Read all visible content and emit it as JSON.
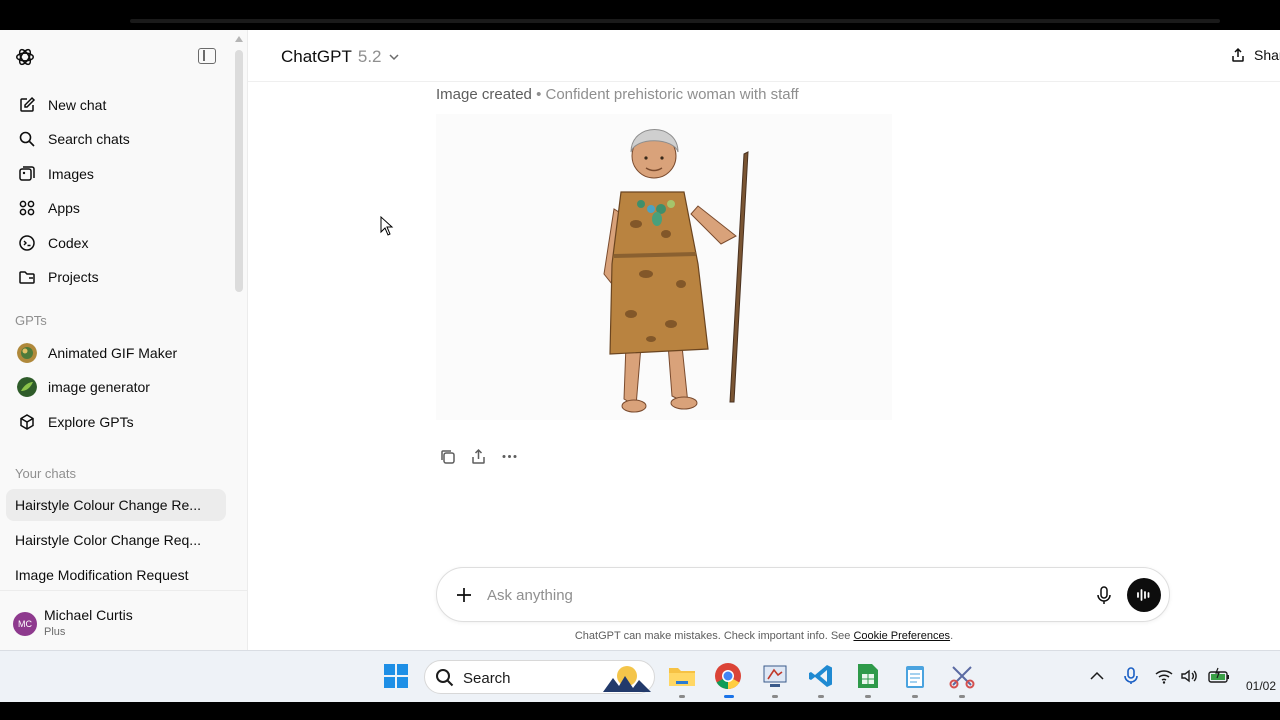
{
  "sidebar": {
    "nav": [
      {
        "label": "New chat",
        "icon": "new-chat-icon"
      },
      {
        "label": "Search chats",
        "icon": "search-icon"
      },
      {
        "label": "Images",
        "icon": "images-icon"
      },
      {
        "label": "Apps",
        "icon": "apps-icon"
      },
      {
        "label": "Codex",
        "icon": "codex-icon"
      },
      {
        "label": "Projects",
        "icon": "projects-icon"
      }
    ],
    "gpts_label": "GPTs",
    "gpts": [
      {
        "label": "Animated GIF Maker"
      },
      {
        "label": "image generator"
      },
      {
        "label": "Explore GPTs"
      }
    ],
    "chats_label": "Your chats",
    "chats": [
      {
        "label": "Hairstyle Colour Change Re...",
        "active": true
      },
      {
        "label": "Hairstyle Color Change Req...",
        "active": false
      },
      {
        "label": "Image Modification Request",
        "active": false
      }
    ],
    "profile": {
      "initials": "MC",
      "name": "Michael Curtis",
      "plan": "Plus"
    }
  },
  "header": {
    "model": "ChatGPT",
    "version": "5.2",
    "share_label": "Shar"
  },
  "message": {
    "status": "Image created",
    "separator": "•",
    "description": "Confident prehistoric woman with staff"
  },
  "composer": {
    "placeholder": "Ask anything"
  },
  "disclaimer": {
    "text": "ChatGPT can make mistakes. Check important info. See ",
    "link": "Cookie Preferences",
    "end": "."
  },
  "taskbar": {
    "search_label": "Search",
    "clock": "01/02"
  },
  "colors": {
    "accent": "#0d0d0d",
    "avatar": "#8e3a8e",
    "sidebar_bg": "#f9f9f9",
    "taskbar_bg": "#eef2f7"
  }
}
